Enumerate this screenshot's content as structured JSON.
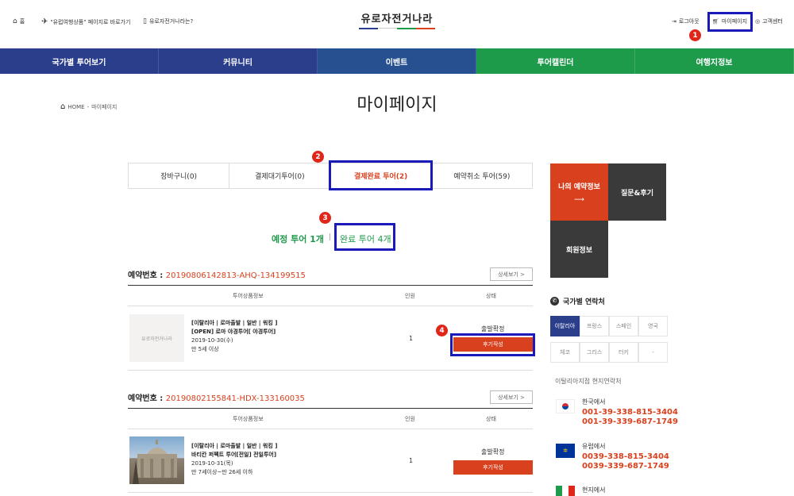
{
  "topbar": {
    "home_label": "홈",
    "packages_label": "\"유럽여행상품\" 페이지로 바로가기",
    "about_label": "유로자전거나라는?",
    "logo_text": "유로자전거나라",
    "login_label": "로그아웃",
    "mypage_label": "마이페이지",
    "support_label": "고객센터"
  },
  "colors": {
    "nav_blue": "#2b3e8c",
    "nav_green": "#1e9a4b",
    "accent_red": "#d9411e",
    "highlight_blue": "#1a1ab8"
  },
  "nav": {
    "items": [
      "국가별 투어보기",
      "커뮤니티",
      "이벤트",
      "투어캘린더",
      "여행지정보"
    ]
  },
  "breadcrumb": {
    "home": "HOME",
    "separator": "-",
    "current": "마이페이지"
  },
  "page_title": "마이페이지",
  "tabs": [
    "장바구니(0)",
    "결제대기투어(0)",
    "결제완료 투어(2)",
    "예약취소 투어(59)"
  ],
  "subtabs": {
    "upcoming": "예정 투어 1개",
    "divider": "|",
    "completed": "완료 투어 4개"
  },
  "annotations": [
    "1",
    "2",
    "3",
    "4"
  ],
  "table_headers": {
    "product": "투어상품정보",
    "people": "인원",
    "status": "상태"
  },
  "bookings": [
    {
      "label": "예약번호 :",
      "number": "20190806142813-AHQ-134199515",
      "detail_label": "상세보기 >",
      "tags": "[이탈리아 | 로마출발 | 일반 | 워킹 ]",
      "title": "[OPEN] 로마 야경투어[ 야경투어]",
      "date": "2019-10-30(수)",
      "age": "만 5세 이상",
      "people": "1",
      "status": "출발확정",
      "review_label": "후기작성",
      "thumb_text": "유로자전거나라"
    },
    {
      "label": "예약번호 :",
      "number": "20190802155841-HDX-133160035",
      "detail_label": "상세보기 >",
      "tags": "[이탈리아 | 로마출발 | 일반 | 워킹 ]",
      "title": "바티칸 퍼펙트 투어[전일] 전일투어]",
      "date": "2019-10-31(목)",
      "age": "만 7세이상~만 26세 이하",
      "people": "1",
      "status": "출발확정",
      "review_label": "후기작성"
    }
  ],
  "side_menu": {
    "reservation": "나의 예약정보",
    "qna": "질문&후기",
    "member": "회원정보"
  },
  "contacts": {
    "title": "국가별 연락처",
    "countries_row1": [
      "이탈리아",
      "프랑스",
      "스페인",
      "영국"
    ],
    "countries_row2": [
      "체코",
      "그리스",
      "터키",
      "-"
    ],
    "branch_title": "이탈리아지점 현지연락처",
    "korea_label": "한국에서",
    "korea_numbers": [
      "001-39-338-815-3404",
      "001-39-339-687-1749"
    ],
    "europe_label": "유럽에서",
    "europe_numbers": [
      "0039-338-815-3404",
      "0039-339-687-1749"
    ],
    "local_label": "현지에서"
  }
}
